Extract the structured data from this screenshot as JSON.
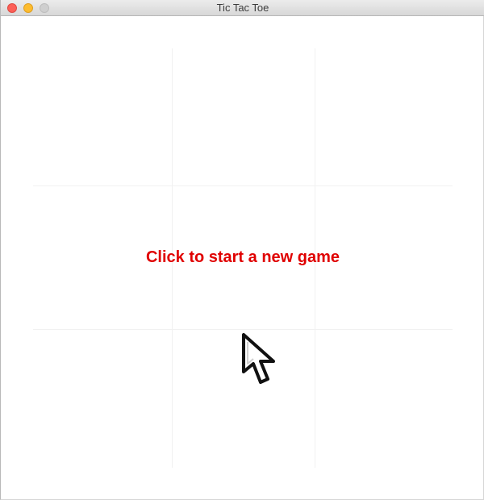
{
  "window": {
    "title": "Tic Tac Toe"
  },
  "game": {
    "message": "Click to start a new game",
    "message_color": "#e00000",
    "board": [
      "",
      "",
      "",
      "",
      "",
      "",
      "",
      "",
      ""
    ]
  },
  "icons": {
    "cursor": "arrow-cursor-icon"
  }
}
